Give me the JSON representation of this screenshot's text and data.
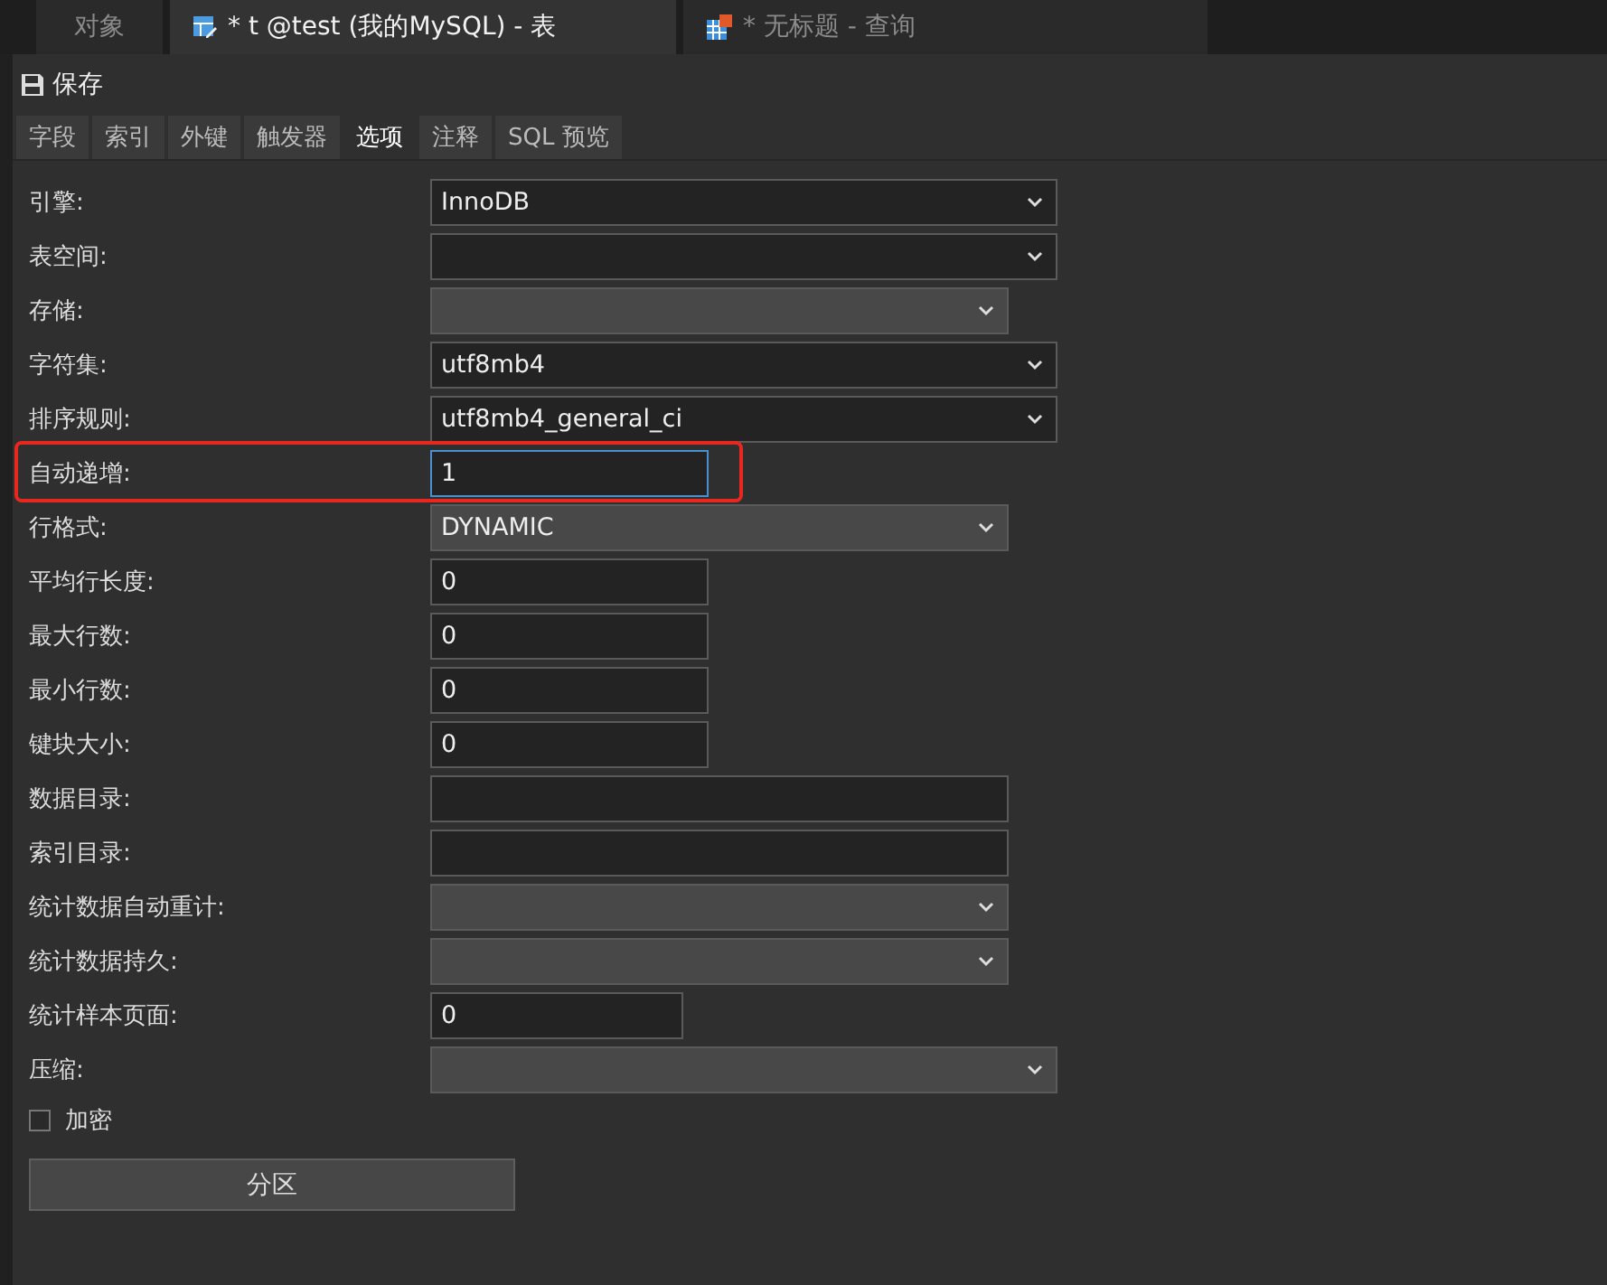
{
  "doc_tabs": [
    {
      "label": "对象",
      "selected": false
    },
    {
      "label": "* t @test (我的MySQL) - 表",
      "selected": true
    },
    {
      "label": "* 无标题 - 查询",
      "selected": false
    }
  ],
  "toolbar": {
    "save": "保存"
  },
  "tabs": [
    {
      "label": "字段",
      "selected": false
    },
    {
      "label": "索引",
      "selected": false
    },
    {
      "label": "外键",
      "selected": false
    },
    {
      "label": "触发器",
      "selected": false
    },
    {
      "label": "选项",
      "selected": true
    },
    {
      "label": "注释",
      "selected": false
    },
    {
      "label": "SQL 预览",
      "selected": false
    }
  ],
  "options": [
    {
      "label": "引擎:",
      "kind": "select",
      "value": "InnoDB",
      "disabled": false
    },
    {
      "label": "表空间:",
      "kind": "select",
      "disabled": false
    },
    {
      "label": "存储:",
      "kind": "select",
      "disabled": true
    },
    {
      "label": "字符集:",
      "kind": "select",
      "value": "utf8mb4",
      "disabled": false
    },
    {
      "label": "排序规则:",
      "kind": "select",
      "value": "utf8mb4_general_ci",
      "disabled": false
    },
    {
      "label": "自动递增:",
      "kind": "input",
      "value": "1",
      "focused": true,
      "highlighted": true
    },
    {
      "label": "行格式:",
      "kind": "select",
      "value": "DYNAMIC",
      "disabled": true
    },
    {
      "label": "平均行长度:",
      "kind": "input",
      "value": "0",
      "focused": false
    },
    {
      "label": "最大行数:",
      "kind": "input",
      "value": "0",
      "focused": false
    },
    {
      "label": "最小行数:",
      "kind": "input",
      "value": "0",
      "focused": false
    },
    {
      "label": "键块大小:",
      "kind": "input",
      "value": "0",
      "focused": false
    },
    {
      "label": "数据目录:",
      "kind": "input",
      "focused": false
    },
    {
      "label": "索引目录:",
      "kind": "input",
      "focused": false
    },
    {
      "label": "统计数据自动重计:",
      "kind": "select",
      "disabled": true
    },
    {
      "label": "统计数据持久:",
      "kind": "select",
      "disabled": true
    },
    {
      "label": "统计样本页面:",
      "kind": "input",
      "value": "0",
      "focused": false
    },
    {
      "label": "压缩:",
      "kind": "select",
      "disabled": true
    }
  ],
  "encrypt": {
    "label": "加密",
    "checked": false
  },
  "partition_button": "分区"
}
